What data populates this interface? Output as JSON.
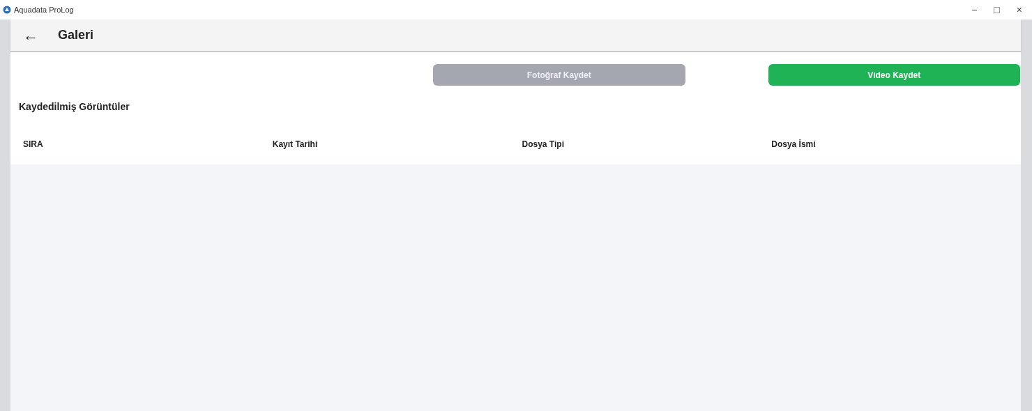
{
  "window": {
    "title": "Aquadata ProLog",
    "controls": [
      "−",
      "□",
      "×"
    ]
  },
  "app_bar": {
    "back": "←",
    "title": "Galeri"
  },
  "buttons": [
    {
      "label": "Fotoğraf Kaydet",
      "disabled": true
    },
    {
      "label": "Video Kaydet",
      "disabled": false
    }
  ],
  "section_title": "Kaydedilmiş Görüntüler",
  "table": {
    "columns": [
      "SIRA",
      "Kayıt Tarihi",
      "Dosya Tipi",
      "Dosya İsmi"
    ]
  }
}
